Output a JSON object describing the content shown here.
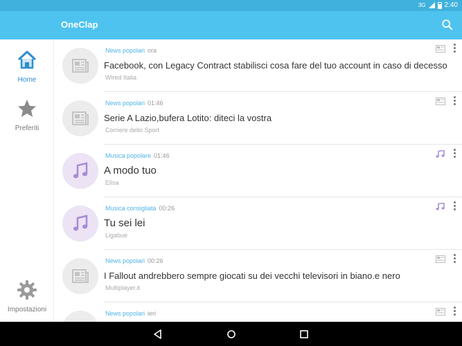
{
  "status_bar": {
    "network": "3G",
    "time": "2:40"
  },
  "app_bar": {
    "title": "OneClap",
    "search_icon": "search-icon"
  },
  "sidebar": {
    "items": [
      {
        "label": "Home",
        "icon": "home-icon",
        "active": true
      },
      {
        "label": "Preferiti",
        "icon": "star-icon",
        "active": false
      },
      {
        "label": "Impostazioni",
        "icon": "gear-icon",
        "active": false
      }
    ]
  },
  "feed": {
    "items": [
      {
        "category": "News popolari",
        "time": "ora",
        "title": "Facebook, con Legacy Contract stabilisci cosa fare del tuo account in caso di decesso",
        "source": "Wired Italia",
        "type": "news"
      },
      {
        "category": "News popolari",
        "time": "01:46",
        "title": "Serie A Lazio,bufera Lotito: diteci la vostra",
        "source": "Corriere dello Sport",
        "type": "news"
      },
      {
        "category": "Musica popolare",
        "time": "01:46",
        "title": "A modo tuo",
        "source": "Elisa",
        "type": "music"
      },
      {
        "category": "Musica consigliata",
        "time": "00:26",
        "title": "Tu sei lei",
        "source": "Ligabue",
        "type": "music"
      },
      {
        "category": "News popolari",
        "time": "00:26",
        "title": "I Fallout andrebbero sempre giocati su dei vecchi televisori in biano.e nero",
        "source": "Multiplayer.it",
        "type": "news"
      },
      {
        "category": "News popolari",
        "time": "ieri",
        "title": "",
        "source": "",
        "type": "news"
      }
    ]
  },
  "colors": {
    "status_bar": "#3fb1dc",
    "app_bar": "#4fc3ef",
    "accent": "#2b8fd1",
    "music": "#a78bd6"
  }
}
